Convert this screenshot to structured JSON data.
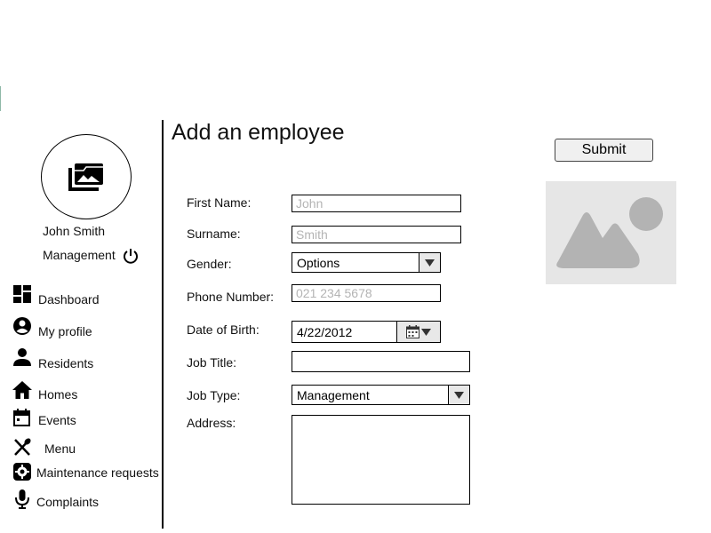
{
  "user": {
    "name": "John Smith",
    "role": "Management",
    "avatar_icon": "photo-library-icon",
    "logout_icon": "power-icon"
  },
  "sidebar": {
    "items": [
      {
        "label": "Dashboard",
        "icon": "dashboard-icon"
      },
      {
        "label": "My profile",
        "icon": "account-circle-icon"
      },
      {
        "label": "Residents",
        "icon": "person-icon"
      },
      {
        "label": "Homes",
        "icon": "home-icon"
      },
      {
        "label": "Events",
        "icon": "calendar-icon"
      },
      {
        "label": "Menu",
        "icon": "utensils-icon"
      },
      {
        "label": "Maintenance requests",
        "icon": "gear-icon"
      },
      {
        "label": "Complaints",
        "icon": "microphone-icon"
      }
    ]
  },
  "page": {
    "title": "Add an employee",
    "submit_label": "Submit",
    "image_icon": "image-placeholder-icon"
  },
  "form": {
    "first_name": {
      "label": "First Name:",
      "value": "",
      "placeholder": "John"
    },
    "surname": {
      "label": "Surname:",
      "value": "",
      "placeholder": "Smith"
    },
    "gender": {
      "label": "Gender:",
      "selected": "Options"
    },
    "phone": {
      "label": "Phone Number:",
      "value": "",
      "placeholder": "021 234 5678"
    },
    "dob": {
      "label": "Date of Birth:",
      "value": "4/22/2012",
      "icon": "calendar-icon"
    },
    "job_title": {
      "label": "Job Title:",
      "value": "",
      "placeholder": ""
    },
    "job_type": {
      "label": "Job Type:",
      "selected": "Management"
    },
    "address": {
      "label": "Address:",
      "value": ""
    }
  },
  "colors": {
    "placeholder_bg": "#e6e6e6",
    "placeholder_shape": "#b3b3b3",
    "button_bg": "#f0f0f0",
    "divider": "#000000"
  }
}
